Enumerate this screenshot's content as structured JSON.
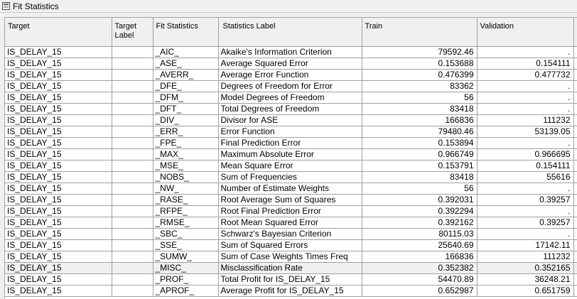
{
  "window": {
    "title": "Fit Statistics",
    "icon": "table-window-icon"
  },
  "columns": [
    "Target",
    "Target Label",
    "Fit Statistics",
    "Statistics Label",
    "Train",
    "Validation"
  ],
  "rows": [
    [
      "IS_DELAY_15",
      "",
      "_AIC_",
      "Akaike's Information Criterion",
      "79592.46",
      "."
    ],
    [
      "IS_DELAY_15",
      "",
      "_ASE_",
      "Average Squared Error",
      "0.153688",
      "0.154111"
    ],
    [
      "IS_DELAY_15",
      "",
      "_AVERR_",
      "Average Error Function",
      "0.476399",
      "0.477732"
    ],
    [
      "IS_DELAY_15",
      "",
      "_DFE_",
      "Degrees of Freedom for Error",
      "83362",
      "."
    ],
    [
      "IS_DELAY_15",
      "",
      "_DFM_",
      "Model Degrees of Freedom",
      "56",
      "."
    ],
    [
      "IS_DELAY_15",
      "",
      "_DFT_",
      "Total Degrees of Freedom",
      "83418",
      "."
    ],
    [
      "IS_DELAY_15",
      "",
      "_DIV_",
      "Divisor for ASE",
      "166836",
      "111232"
    ],
    [
      "IS_DELAY_15",
      "",
      "_ERR_",
      "Error Function",
      "79480.46",
      "53139.05"
    ],
    [
      "IS_DELAY_15",
      "",
      "_FPE_",
      "Final Prediction Error",
      "0.153894",
      "."
    ],
    [
      "IS_DELAY_15",
      "",
      "_MAX_",
      "Maximum Absolute Error",
      "0.966749",
      "0.966695"
    ],
    [
      "IS_DELAY_15",
      "",
      "_MSE_",
      "Mean Square Error",
      "0.153791",
      "0.154111"
    ],
    [
      "IS_DELAY_15",
      "",
      "_NOBS_",
      "Sum of Frequencies",
      "83418",
      "55616"
    ],
    [
      "IS_DELAY_15",
      "",
      "_NW_",
      "Number of Estimate Weights",
      "56",
      "."
    ],
    [
      "IS_DELAY_15",
      "",
      "_RASE_",
      "Root Average Sum of Squares",
      "0.392031",
      "0.39257"
    ],
    [
      "IS_DELAY_15",
      "",
      "_RFPE_",
      "Root Final Prediction Error",
      "0.392294",
      "."
    ],
    [
      "IS_DELAY_15",
      "",
      "_RMSE_",
      "Root Mean Squared Error",
      "0.392162",
      "0.39257"
    ],
    [
      "IS_DELAY_15",
      "",
      "_SBC_",
      "Schwarz's Bayesian Criterion",
      "80115.03",
      "."
    ],
    [
      "IS_DELAY_15",
      "",
      "_SSE_",
      "Sum of Squared Errors",
      "25640.69",
      "17142.11"
    ],
    [
      "IS_DELAY_15",
      "",
      "_SUMW_",
      "Sum of Case Weights Times Freq",
      "166836",
      "111232"
    ],
    [
      "IS_DELAY_15",
      "",
      "_MISC_",
      "Misclassification Rate",
      "0.352382",
      "0.352165"
    ],
    [
      "IS_DELAY_15",
      "",
      "_PROF_",
      "Total Profit for IS_DELAY_15",
      "54470.89",
      "36248.21"
    ],
    [
      "IS_DELAY_15",
      "",
      "_APROF_",
      "Average Profit for IS_DELAY_15",
      "0.652987",
      "0.651759"
    ]
  ]
}
